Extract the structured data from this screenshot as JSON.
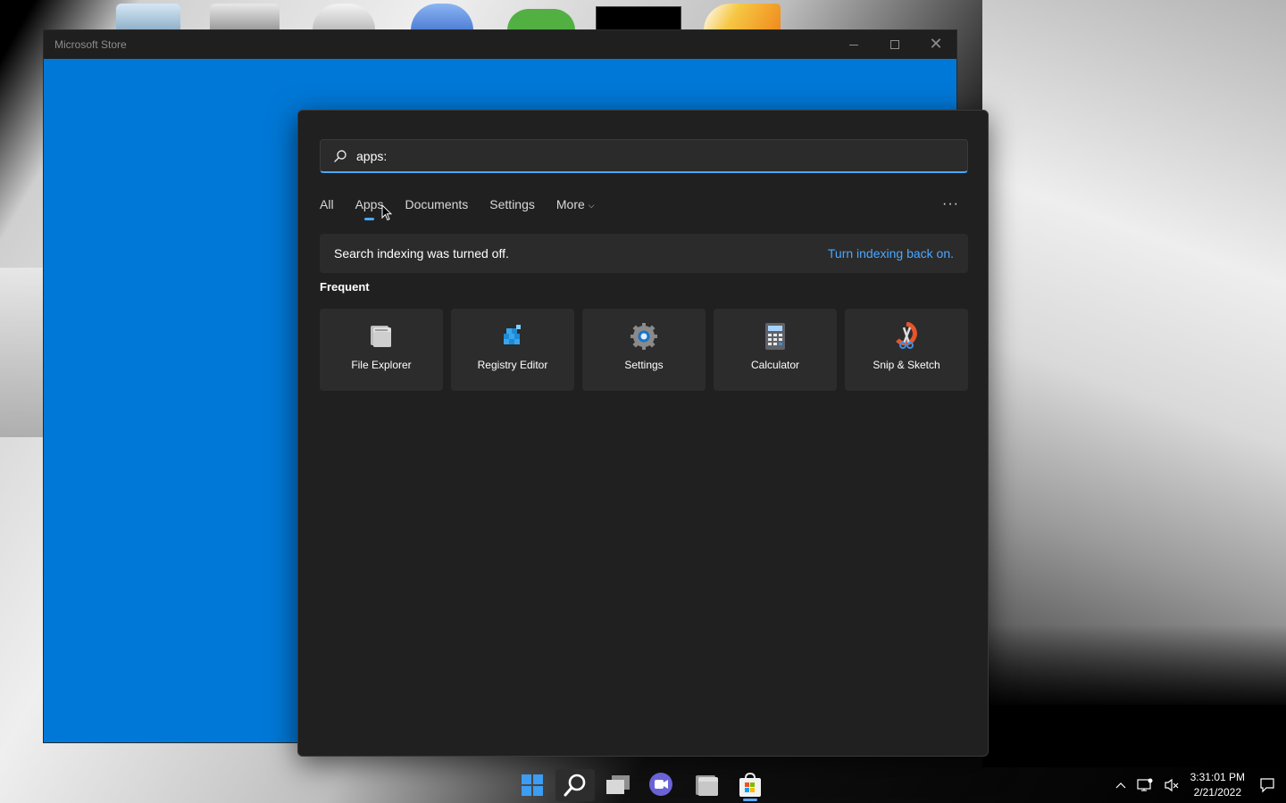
{
  "store_window": {
    "title": "Microsoft Store",
    "accent_color": "#0078d7"
  },
  "search": {
    "query": "apps:",
    "tabs": [
      {
        "label": "All",
        "active": false
      },
      {
        "label": "Apps",
        "active": true
      },
      {
        "label": "Documents",
        "active": false
      },
      {
        "label": "Settings",
        "active": false
      },
      {
        "label": "More",
        "active": false
      }
    ],
    "notice": {
      "text": "Search indexing was turned off.",
      "link": "Turn indexing back on."
    },
    "section_title": "Frequent",
    "apps": [
      {
        "label": "File Explorer",
        "icon": "file-explorer-icon"
      },
      {
        "label": "Registry Editor",
        "icon": "registry-editor-icon"
      },
      {
        "label": "Settings",
        "icon": "settings-gear-icon"
      },
      {
        "label": "Calculator",
        "icon": "calculator-icon"
      },
      {
        "label": "Snip & Sketch",
        "icon": "snip-sketch-icon"
      }
    ],
    "accent_color": "#4aa8ff"
  },
  "taskbar": {
    "icons": [
      "start-icon",
      "search-icon",
      "task-view-icon",
      "teams-chat-icon",
      "file-explorer-icon",
      "microsoft-store-icon"
    ],
    "active": "search-icon",
    "clock": {
      "time": "3:31:01 PM",
      "date": "2/21/2022"
    }
  }
}
